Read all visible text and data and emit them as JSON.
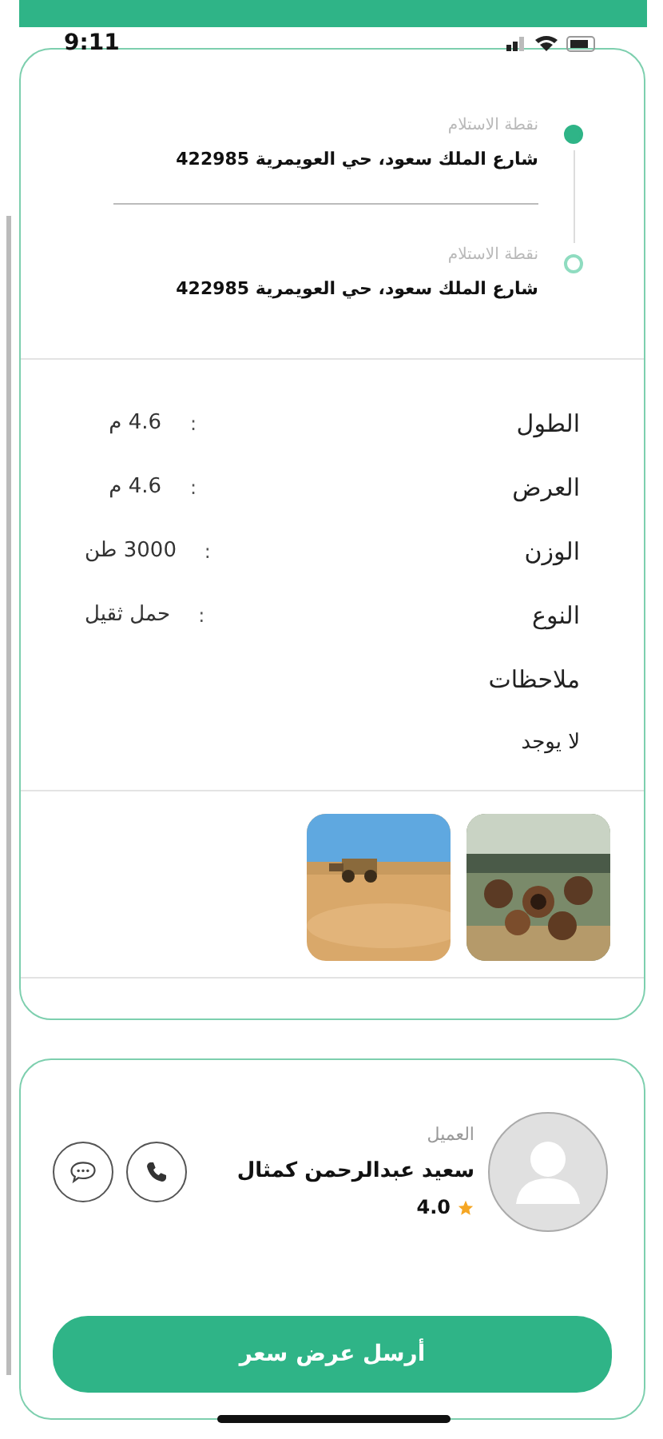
{
  "status_bar": {
    "time": "9:11"
  },
  "route": [
    {
      "label": "نقطة الاستلام",
      "address": "شارع الملك سعود، حي العويمرية 422985",
      "active": true
    },
    {
      "label": "نقطة الاستلام",
      "address": "شارع الملك سعود، حي العويمرية 422985",
      "active": false
    }
  ],
  "details": [
    {
      "label": "الطول",
      "separator": ":",
      "value": "4.6 م"
    },
    {
      "label": "العرض",
      "separator": ":",
      "value": "4.6 م"
    },
    {
      "label": "الوزن",
      "separator": ":",
      "value": "3000 طن"
    },
    {
      "label": "النوع",
      "separator": ":",
      "value": "حمل ثقيل"
    }
  ],
  "notes": {
    "label": "ملاحظات",
    "value": "لا يوجد"
  },
  "customer": {
    "role": "العميل",
    "name": "سعيد عبدالرحمن كمثال",
    "rating": "4.0"
  },
  "action_button": "أرسل عرض سعر"
}
